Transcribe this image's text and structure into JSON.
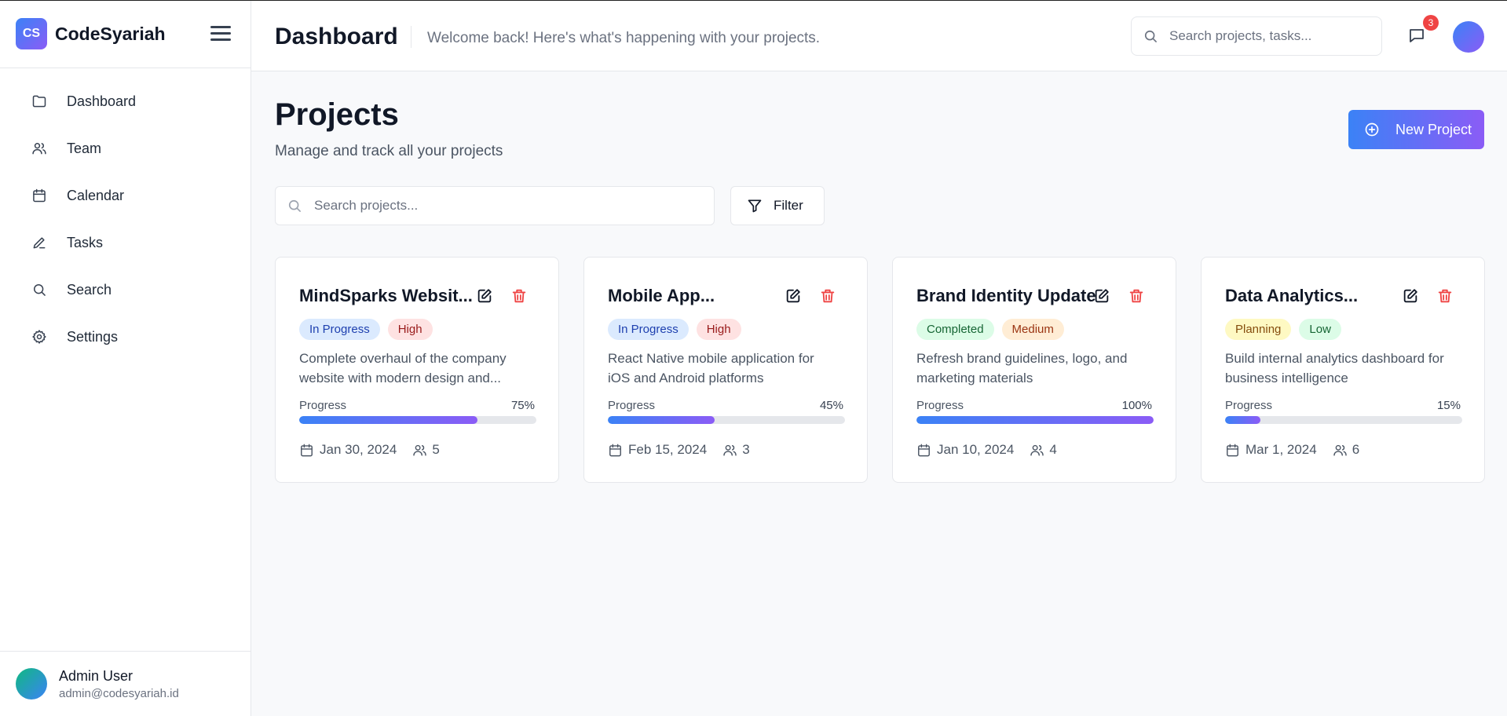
{
  "brand": {
    "initials": "CS",
    "name": "CodeSyariah"
  },
  "sidebar": {
    "items": [
      {
        "label": "Dashboard",
        "icon": "folder-icon"
      },
      {
        "label": "Team",
        "icon": "users-icon"
      },
      {
        "label": "Calendar",
        "icon": "calendar-icon"
      },
      {
        "label": "Tasks",
        "icon": "pencil-icon"
      },
      {
        "label": "Search",
        "icon": "search-icon"
      },
      {
        "label": "Settings",
        "icon": "gear-icon"
      }
    ],
    "user": {
      "name": "Admin User",
      "email": "admin@codesyariah.id"
    }
  },
  "header": {
    "title": "Dashboard",
    "subtitle": "Welcome back! Here's what's happening with your projects.",
    "search_placeholder": "Search projects, tasks...",
    "notification_count": "3"
  },
  "page": {
    "title": "Projects",
    "subtitle": "Manage and track all your projects",
    "new_button": "New Project",
    "search_placeholder": "Search projects...",
    "filter_label": "Filter"
  },
  "colors": {
    "accent_start": "#3b82f6",
    "accent_end": "#8b5cf6",
    "danger": "#ef4444"
  },
  "projects": [
    {
      "title": "MindSparks Websit...",
      "status": "In Progress",
      "priority": "High",
      "description_line1": "Complete overhaul of the company",
      "description_line2": "website with modern design and...",
      "progress_label": "Progress",
      "progress": "75%",
      "due": "Jan 30, 2024",
      "members": "5"
    },
    {
      "title": "Mobile App...",
      "status": "In Progress",
      "priority": "High",
      "description_line1": "React Native mobile application for",
      "description_line2": "iOS and Android platforms",
      "progress_label": "Progress",
      "progress": "45%",
      "due": "Feb 15, 2024",
      "members": "3"
    },
    {
      "title": "Brand Identity Update",
      "status": "Completed",
      "priority": "Medium",
      "description_line1": "Refresh brand guidelines, logo, and",
      "description_line2": "marketing materials",
      "progress_label": "Progress",
      "progress": "100%",
      "due": "Jan 10, 2024",
      "members": "4"
    },
    {
      "title": "Data Analytics...",
      "status": "Planning",
      "priority": "Low",
      "description_line1": "Build internal analytics dashboard for",
      "description_line2": "business intelligence",
      "progress_label": "Progress",
      "progress": "15%",
      "due": "Mar 1, 2024",
      "members": "6"
    }
  ],
  "tag_styles": {
    "In Progress": {
      "bg": "#dbeafe",
      "fg": "#1e40af"
    },
    "Completed": {
      "bg": "#dcfce7",
      "fg": "#166534"
    },
    "Planning": {
      "bg": "#fef9c3",
      "fg": "#854d0e"
    },
    "High": {
      "bg": "#fee2e2",
      "fg": "#991b1b"
    },
    "Medium": {
      "bg": "#ffedd5",
      "fg": "#9a3412"
    },
    "Low": {
      "bg": "#dcfce7",
      "fg": "#166534"
    }
  }
}
